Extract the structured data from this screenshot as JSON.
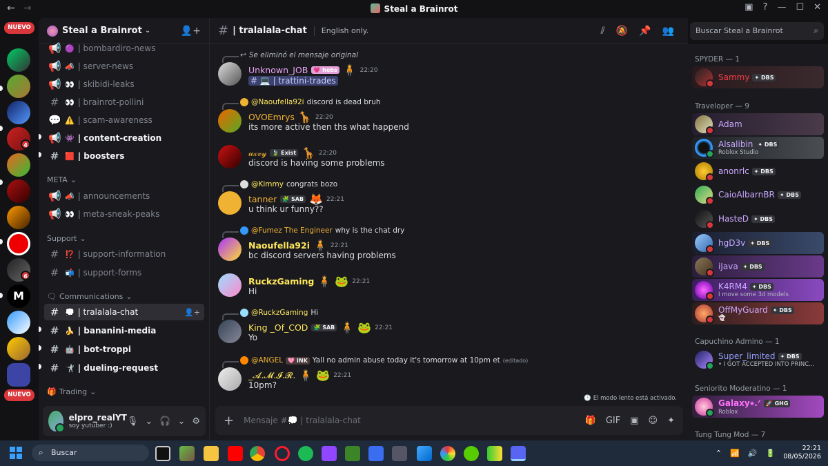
{
  "window": {
    "title": "Steal a Brainrot"
  },
  "rail": {
    "badge_new_top": "NUEVO",
    "badge_new_bottom": "NUEVO",
    "counts": [
      "4",
      "6"
    ]
  },
  "server": {
    "name": "Steal a Brainrot"
  },
  "channels": [
    {
      "name": "| bombardiro-news",
      "emoji": "🟣",
      "kind": "announce"
    },
    {
      "name": "| server-news",
      "emoji": "📣",
      "kind": "announce"
    },
    {
      "name": "| skibidi-leaks",
      "emoji": "👀",
      "kind": "announce"
    },
    {
      "name": "| brainrot-pollini",
      "emoji": "👀",
      "kind": "text"
    },
    {
      "name": "| scam-awareness",
      "emoji": "⚠️",
      "kind": "forum"
    },
    {
      "name": "| content-creation",
      "emoji": "👾",
      "kind": "announce",
      "unread": true
    },
    {
      "name": "| boosters",
      "emoji": "🟥",
      "kind": "text",
      "unread": true
    }
  ],
  "category_meta": "META",
  "meta_channels": [
    {
      "name": "| announcements",
      "emoji": "📣",
      "kind": "announce"
    },
    {
      "name": "| meta-sneak-peaks",
      "emoji": "👀",
      "kind": "announce"
    }
  ],
  "category_support": "Support",
  "support_channels": [
    {
      "name": "| support-information",
      "emoji": "⁉️",
      "kind": "text"
    },
    {
      "name": "| support-forms",
      "emoji": "📬",
      "kind": "text"
    }
  ],
  "category_comms": "Communications",
  "comms_channels": [
    {
      "name": "| tralalala-chat",
      "emoji": "💭",
      "active": true
    },
    {
      "name": "| bananini-media",
      "emoji": "🍌",
      "unread": true
    },
    {
      "name": "| bot-troppi",
      "emoji": "🤖",
      "unread": true
    },
    {
      "name": "| dueling-request",
      "emoji": "🤺",
      "unread": true
    }
  ],
  "category_trading": "Trading",
  "user": {
    "name": "elpro_realYT",
    "status": "soy yutuber :)"
  },
  "header": {
    "channel": "| tralalala-chat",
    "topic": "English only."
  },
  "search_placeholder": "Buscar Steal a Brainrot",
  "messages": [
    {
      "reply_name": "Se eliminó el mensaje original",
      "reply_text": "",
      "name": "Unknown_JOB",
      "color": "#e8a4f5",
      "tag": "hebs",
      "time": "22:20",
      "body": "",
      "mention": "# 💻 | trattini-trades"
    },
    {
      "reply_name": "@Naoufella92i",
      "reply_text": "discord is dead bruh",
      "name": "OVOEmrys",
      "color": "#f0b232",
      "tag": "",
      "time": "22:20",
      "body": "its more active then ths what happend"
    },
    {
      "reply_name": "",
      "reply_text": "",
      "name": "𝓊𝓍𝓋𝓎",
      "color": "#f0b232",
      "tag": "Exist",
      "time": "22:20",
      "body": "discord is having some problems"
    },
    {
      "reply_name": "@Kimmy",
      "reply_text": "congrats bozo",
      "name": "tanner",
      "color": "#f0b232",
      "tag": "SAB",
      "time": "22:21",
      "body": "u think ur funny??"
    },
    {
      "reply_name": "@Fumez The Engineer",
      "reply_text": "why is the chat dry",
      "name": "Naoufella92i",
      "color": "#fee75c",
      "tag": "",
      "time": "22:21",
      "body": "bc discord servers having problems"
    },
    {
      "reply_name": "",
      "reply_text": "",
      "name": "RuckzGaming",
      "color": "#fee75c",
      "tag": "",
      "time": "22:21",
      "body": "Hi"
    },
    {
      "reply_name": "@RuckzGaming",
      "reply_text": "Hi",
      "name": "King _Of_COD",
      "color": "#fee75c",
      "tag": "SAB",
      "time": "22:21",
      "body": "Yo"
    },
    {
      "reply_name": "@ANGEL",
      "reply_text": "Yall no admin abuse today it's tomorrow at 10pm et",
      "reply_edit": "(editado)",
      "reply_tag": "INK",
      "name": "_𝓐.𝓜.𝓘.𝓡.",
      "color": "#fee75c",
      "tag": "",
      "time": "22:21",
      "body": "10pm?"
    }
  ],
  "slowmode": "El modo lento está activado.",
  "composer_placeholder": "Mensaje #💭 | tralalala-chat",
  "member_groups": [
    {
      "title": "SPYDER — 1"
    },
    {
      "title": "Traveloper — 9"
    },
    {
      "title": "Capuchino Admino — 1"
    },
    {
      "title": "Seniorito Moderatino — 1"
    },
    {
      "title": "Tung Tung Mod — 7"
    }
  ],
  "members": [
    {
      "name": "Sammy",
      "color": "#f23f43",
      "tag": "DBS",
      "sub": ""
    },
    {
      "name": "Adam",
      "color": "#c9a7ff",
      "tag": "",
      "sub": ""
    },
    {
      "name": "Alsalibin",
      "color": "#c9a7ff",
      "tag": "DBS",
      "sub": "Roblox Studio"
    },
    {
      "name": "anonrlc",
      "color": "#c9a7ff",
      "tag": "DBS",
      "sub": ""
    },
    {
      "name": "CaioAlbarnBR",
      "color": "#c9a7ff",
      "tag": "DBS",
      "sub": ""
    },
    {
      "name": "HasteD",
      "color": "#c9a7ff",
      "tag": "DBS",
      "sub": ""
    },
    {
      "name": "hgD3v",
      "color": "#c9a7ff",
      "tag": "DBS",
      "sub": ""
    },
    {
      "name": "iJava",
      "color": "#c9a7ff",
      "tag": "DBS",
      "sub": ""
    },
    {
      "name": "K4RM4",
      "color": "#c9a7ff",
      "tag": "DBS",
      "sub": "I move some 3d models"
    },
    {
      "name": "OffMyGuard",
      "color": "#c9a7ff",
      "tag": "DBS",
      "sub": ""
    },
    {
      "name": "Super_limited",
      "color": "#949cf7",
      "tag": "DBS",
      "sub": "• I GOT ACCEPTED INTO PRINC..."
    },
    {
      "name": "Galaxy⭑.ᐟ",
      "color": "#ff73fa",
      "tag": "GHG",
      "sub": "Roblox"
    }
  ],
  "taskbar": {
    "search": "Buscar",
    "time": "22:21",
    "date": "08/05/2026"
  }
}
